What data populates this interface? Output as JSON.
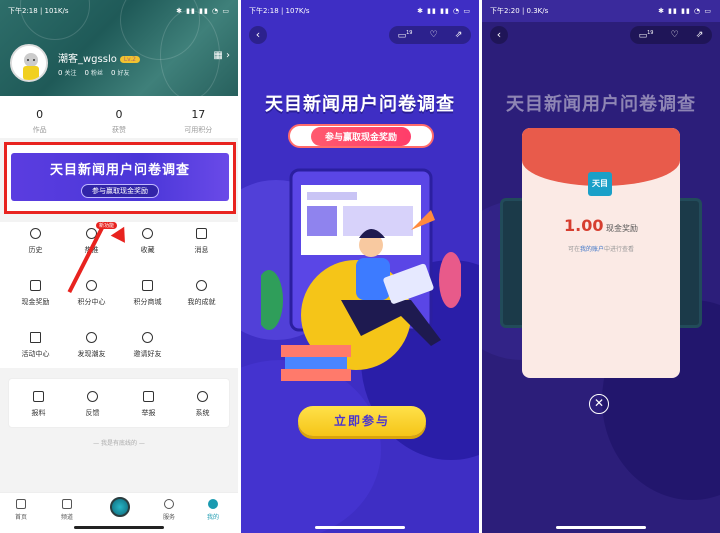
{
  "phone1": {
    "status": {
      "time": "下午2:18",
      "speed": "101K/s"
    },
    "user": {
      "name": "潮客_wgsslo",
      "level": "Lv.2",
      "follow_count": "0",
      "follow_label": "关注",
      "fans_count": "0",
      "fans_label": "粉丝",
      "friends_count": "0",
      "friends_label": "好友"
    },
    "stats": [
      {
        "value": "0",
        "label": "作品"
      },
      {
        "value": "0",
        "label": "获赞"
      },
      {
        "value": "17",
        "label": "可用积分"
      }
    ],
    "banner": {
      "title": "天目新闻用户问卷调查",
      "subtitle": "参与赢取现金奖励"
    },
    "grid": [
      {
        "label": "历史",
        "icon": "clock-icon"
      },
      {
        "label": "热推",
        "icon": "fire-icon",
        "badge": "新功能"
      },
      {
        "label": "收藏",
        "icon": "star-icon"
      },
      {
        "label": "消息",
        "icon": "mail-icon"
      },
      {
        "label": "现金奖励",
        "icon": "wallet-icon"
      },
      {
        "label": "积分中心",
        "icon": "points-icon"
      },
      {
        "label": "积分商城",
        "icon": "shop-icon"
      },
      {
        "label": "我的成就",
        "icon": "medal-icon"
      },
      {
        "label": "活动中心",
        "icon": "flag-icon"
      },
      {
        "label": "发现潮友",
        "icon": "chat-icon"
      },
      {
        "label": "邀请好友",
        "icon": "invite-icon"
      }
    ],
    "grid2": [
      {
        "label": "报料",
        "icon": "report-icon"
      },
      {
        "label": "反馈",
        "icon": "feedback-icon"
      },
      {
        "label": "举报",
        "icon": "alert-icon"
      },
      {
        "label": "系统",
        "icon": "settings-icon"
      }
    ],
    "footer": "— 我是有底线的 —",
    "tabs": [
      {
        "label": "首页"
      },
      {
        "label": "频道"
      },
      {
        "label": "服务"
      },
      {
        "label": "我的"
      }
    ]
  },
  "phone2": {
    "status": {
      "time": "下午2:18",
      "speed": "107K/s"
    },
    "comment_count": "19",
    "title": "天目新闻用户问卷调查",
    "subtitle": "参与赢取现金奖励",
    "join_label": "立即参与"
  },
  "phone3": {
    "status": {
      "time": "下午2:20",
      "speed": "0.3K/s"
    },
    "comment_count": "19",
    "title": "天目新闻用户问卷调查",
    "logo_text": "天目",
    "amount": "1.00",
    "amount_label": "现金奖励",
    "hint_before": "可在",
    "hint_link": "我的账户",
    "hint_after": "中进行查看"
  },
  "colors": {
    "highlight": "#e8231f",
    "purple": "#3e2ec4",
    "red_envelope": "#e85b4b",
    "yellow_button": "#f5c518"
  }
}
